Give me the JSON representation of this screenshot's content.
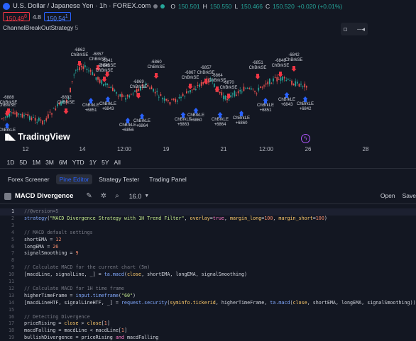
{
  "chart": {
    "symbol_title": "U.S. Dollar / Japanese Yen · 1h · FOREX.com",
    "ohlc_labels": [
      "O",
      "H",
      "L",
      "C"
    ],
    "ohlc_values": [
      "150.501",
      "150.550",
      "150.466",
      "150.520"
    ],
    "change": "+0.020 (+0.01%)",
    "sell_price": "150.49",
    "sell_suffix": "8",
    "spread": "4.8",
    "buy_price": "150.54",
    "buy_suffix": "1",
    "indicator_name": "ChannelBreakOutStrategy",
    "indicator_param": "5",
    "logo_text": "TradingView",
    "x_ticks": [
      "12",
      "14",
      "12:00",
      "19",
      "21",
      "12:00",
      "26",
      "28"
    ],
    "colors": {
      "up": "#26a69a",
      "down": "#ef5350",
      "sell_signal": "#f23645",
      "buy_signal": "#2962ff",
      "accent": "#2962ff"
    }
  },
  "signals": [
    {
      "label": "-6888",
      "tag": "ChBrkSE",
      "type": "short"
    },
    {
      "label": "ChBrkSE",
      "tag": "",
      "type": "short"
    },
    {
      "label": "ChBrkLE",
      "tag": "",
      "type": "long"
    },
    {
      "label": "-6892",
      "tag": "ChBrkSE",
      "type": "short"
    },
    {
      "label": "-6862",
      "tag": "ChBrkSE",
      "type": "short"
    },
    {
      "label": "-6857",
      "tag": "ChBrkSE",
      "type": "short"
    },
    {
      "label": "-6841",
      "tag": "ChBrkSE",
      "type": "short"
    },
    {
      "label": "-6845",
      "tag": "ChBrkSE",
      "type": "short"
    },
    {
      "label": "ChBrkLE",
      "tag": "+6851",
      "type": "long"
    },
    {
      "label": "ChBrkLE",
      "tag": "+6843",
      "type": "long"
    },
    {
      "label": "-6860",
      "tag": "ChBrkSE",
      "type": "short"
    },
    {
      "label": "-6869",
      "tag": "ChBrkSE",
      "type": "short"
    },
    {
      "label": "ChBrkLE",
      "tag": "+6856",
      "type": "long"
    },
    {
      "label": "ChBrkLE",
      "tag": "+6864",
      "type": "long"
    },
    {
      "label": "-6867",
      "tag": "ChBrkSE",
      "type": "short"
    },
    {
      "label": "-6857",
      "tag": "ChBrkSE",
      "type": "short"
    },
    {
      "label": "ChBrkLE",
      "tag": "+6863",
      "type": "long"
    },
    {
      "label": "ChBrkLE",
      "tag": "+6860",
      "type": "long"
    },
    {
      "label": "-6864",
      "tag": "ChBrkSE",
      "type": "short"
    },
    {
      "label": "-6870",
      "tag": "ChBrkSE",
      "type": "short"
    },
    {
      "label": "ChBrkLE",
      "tag": "+6864",
      "type": "long"
    },
    {
      "label": "ChBrkLE",
      "tag": "+6860",
      "type": "long"
    },
    {
      "label": "-6851",
      "tag": "ChBrkSE",
      "type": "short"
    },
    {
      "label": "ChBrkLE",
      "tag": "+6851",
      "type": "long"
    },
    {
      "label": "-6848",
      "tag": "ChBrkSE",
      "type": "short"
    },
    {
      "label": "-6842",
      "tag": "ChBrkSE",
      "type": "short"
    },
    {
      "label": "ChBrkLE",
      "tag": "+6843",
      "type": "long"
    },
    {
      "label": "ChBrkLE",
      "tag": "+6842",
      "type": "long"
    }
  ],
  "timeframes": [
    "1D",
    "5D",
    "1M",
    "3M",
    "6M",
    "YTD",
    "1Y",
    "5Y",
    "All"
  ],
  "tabs": [
    {
      "label": "Forex Screener",
      "active": false
    },
    {
      "label": "Pine Editor",
      "active": true
    },
    {
      "label": "Strategy Tester",
      "active": false
    },
    {
      "label": "Trading Panel",
      "active": false
    }
  ],
  "editor": {
    "title": "MACD Divergence",
    "version": "16.0",
    "open_label": "Open",
    "save_label": "Save",
    "icons": [
      "file-icon",
      "pencil-icon",
      "bug-icon",
      "search-icon",
      "chevron-down-icon"
    ]
  },
  "code_lines": [
    {
      "n": "1",
      "text": "//@version=5",
      "hl": true
    },
    {
      "n": "2",
      "text": "strategy(\"MACD Divergence Strategy with 1H Trend Filter\", overlay=true, margin_long=100, margin_short=100)"
    },
    {
      "n": "3",
      "text": ""
    },
    {
      "n": "4",
      "text": "// MACD default settings"
    },
    {
      "n": "5",
      "text": "shortEMA = 12"
    },
    {
      "n": "6",
      "text": "longEMA = 26"
    },
    {
      "n": "7",
      "text": "signalSmoothing = 9"
    },
    {
      "n": "8",
      "text": ""
    },
    {
      "n": "9",
      "text": "// Calculate MACD for the current chart (5m)"
    },
    {
      "n": "10",
      "text": "[macdLine, signalLine, _] = ta.macd(close, shortEMA, longEMA, signalSmoothing)"
    },
    {
      "n": "11",
      "text": ""
    },
    {
      "n": "12",
      "text": "// Calculate MACD for 1H time frame"
    },
    {
      "n": "13",
      "text": "higherTimeFrame = input.timeframe(\"60\")"
    },
    {
      "n": "14",
      "text": "[macdLineHTF, signalLineHTF, _] = request.security(syminfo.tickerid, higherTimeFrame, ta.macd(close, shortEMA, longEMA, signalSmoothing))"
    },
    {
      "n": "15",
      "text": ""
    },
    {
      "n": "16",
      "text": "// Detecting Divergence"
    },
    {
      "n": "17",
      "text": "priceRising = close > close[1]"
    },
    {
      "n": "18",
      "text": "macdFalling = macdLine < macdLine[1]"
    },
    {
      "n": "19",
      "text": "bullishDivergence = priceRising and macdFalling"
    }
  ]
}
